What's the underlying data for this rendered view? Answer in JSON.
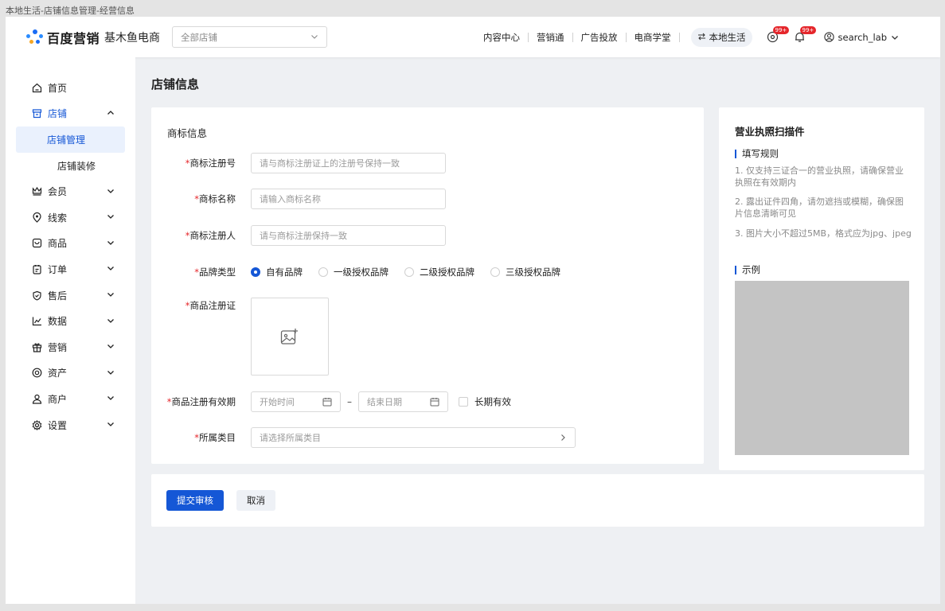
{
  "window": {
    "caption": "本地生活-店铺信息管理-经营信息"
  },
  "header": {
    "brand": "百度营销",
    "product": "基木鱼电商",
    "store_select": {
      "value": "全部店铺"
    },
    "nav": [
      {
        "label": "内容中心"
      },
      {
        "label": "营销通"
      },
      {
        "label": "广告投放"
      },
      {
        "label": "电商学堂"
      }
    ],
    "local_life": "本地生活",
    "message_badge": "99+",
    "notification_badge": "99+",
    "user": "search_lab"
  },
  "sidebar": {
    "items": [
      {
        "label": "首页"
      },
      {
        "label": "店铺"
      },
      {
        "label": "会员"
      },
      {
        "label": "线索"
      },
      {
        "label": "商品"
      },
      {
        "label": "订单"
      },
      {
        "label": "售后"
      },
      {
        "label": "数据"
      },
      {
        "label": "营销"
      },
      {
        "label": "资产"
      },
      {
        "label": "商户"
      },
      {
        "label": "设置"
      }
    ],
    "store_sub": [
      {
        "label": "店铺管理"
      },
      {
        "label": "店铺装修"
      }
    ]
  },
  "main": {
    "title": "店铺信息",
    "form": {
      "section_title": "商标信息",
      "required_mark": "*",
      "reg_no": {
        "label": "商标注册号",
        "placeholder": "请与商标注册证上的注册号保持一致"
      },
      "name": {
        "label": "商标名称",
        "placeholder": "请输入商标名称"
      },
      "registrant": {
        "label": "商标注册人",
        "placeholder": "请与商标注册保持一致"
      },
      "brand_type": {
        "label": "品牌类型",
        "options": [
          "自有品牌",
          "一级授权品牌",
          "二级授权品牌",
          "三级授权品牌"
        ],
        "selected": "自有品牌"
      },
      "certificate": {
        "label": "商品注册证"
      },
      "validity": {
        "label": "商品注册有效期",
        "start_placeholder": "开始时间",
        "separator": "–",
        "end_placeholder": "结束日期",
        "long_term": "长期有效"
      },
      "category": {
        "label": "所属类目",
        "placeholder": "请选择所属类目"
      }
    },
    "license_panel": {
      "title": "营业执照扫描件",
      "rules_title": "填写规则",
      "rules": [
        "1. 仅支持三证合一的营业执照，请确保营业执照在有效期内",
        "2. 露出证件四角，请勿遮挡或模糊，确保图片信息清晰可见",
        "3. 图片大小不超过5MB，格式应为jpg、jpeg"
      ],
      "example_title": "示例"
    },
    "actions": {
      "submit": "提交审核",
      "cancel": "取消"
    }
  },
  "colors": {
    "primary": "#1557d6",
    "required": "#e5262b",
    "badge": "#e5262b"
  }
}
